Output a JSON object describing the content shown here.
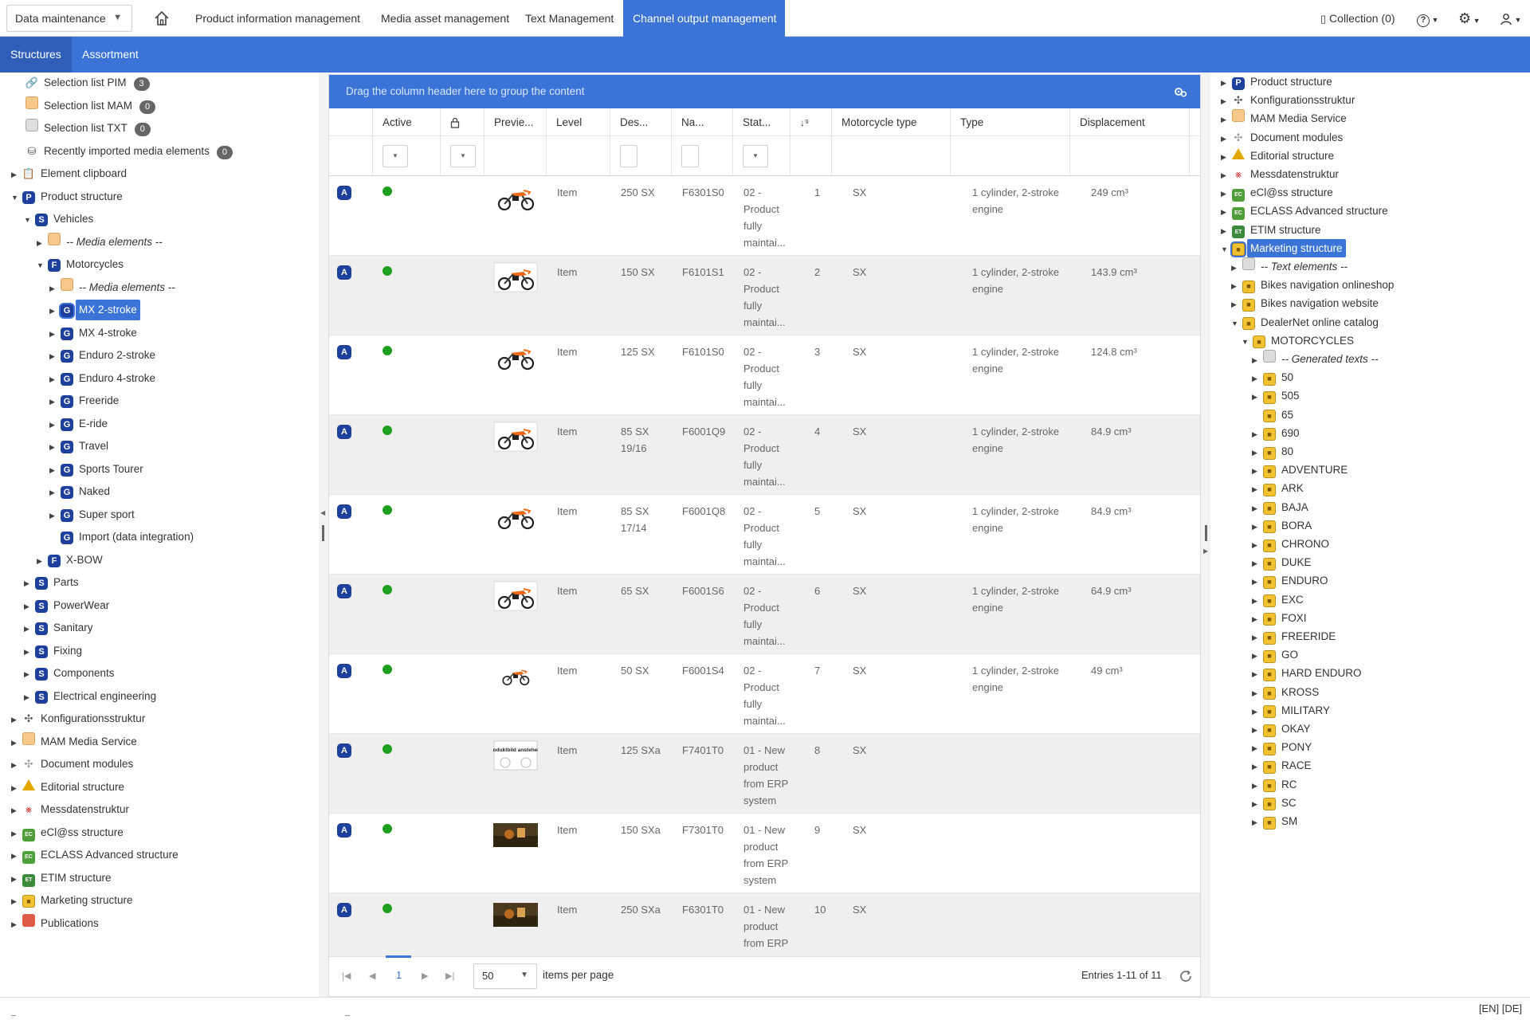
{
  "topbar": {
    "mode_select": "Data maintenance",
    "nav_tabs": [
      "Product information management",
      "Media asset management",
      "Text Management",
      "Channel output management"
    ],
    "collection": "Collection (0)"
  },
  "subtabs": [
    "Structures",
    "Assortment"
  ],
  "left_tree": [
    {
      "label": "Selection list PIM",
      "badge": "3"
    },
    {
      "label": "Selection list MAM",
      "badge": "0"
    },
    {
      "label": "Selection list TXT",
      "badge": "0"
    },
    {
      "label": "Recently imported media elements",
      "badge": "0"
    },
    {
      "label": "Element clipboard"
    },
    {
      "label": "Product structure"
    },
    {
      "label": "Vehicles"
    },
    {
      "label": "-- Media elements --"
    },
    {
      "label": "Motorcycles"
    },
    {
      "label": "-- Media elements --"
    },
    {
      "label": "MX 2-stroke"
    },
    {
      "label": "MX 4-stroke"
    },
    {
      "label": "Enduro 2-stroke"
    },
    {
      "label": "Enduro 4-stroke"
    },
    {
      "label": "Freeride"
    },
    {
      "label": "E-ride"
    },
    {
      "label": "Travel"
    },
    {
      "label": "Sports Tourer"
    },
    {
      "label": "Naked"
    },
    {
      "label": "Super sport"
    },
    {
      "label": "Import (data integration)"
    },
    {
      "label": "X-BOW"
    },
    {
      "label": "Parts"
    },
    {
      "label": "PowerWear"
    },
    {
      "label": "Sanitary"
    },
    {
      "label": "Fixing"
    },
    {
      "label": "Components"
    },
    {
      "label": "Electrical engineering"
    },
    {
      "label": "Konfigurationsstruktur"
    },
    {
      "label": "MAM Media Service"
    },
    {
      "label": "Document modules"
    },
    {
      "label": "Editorial structure"
    },
    {
      "label": "Messdatenstruktur"
    },
    {
      "label": "eCl@ss structure"
    },
    {
      "label": "ECLASS Advanced structure"
    },
    {
      "label": "ETIM structure"
    },
    {
      "label": "Marketing structure"
    },
    {
      "label": "Publications"
    }
  ],
  "grid": {
    "group_hint": "Drag the column header here to group the content",
    "columns": [
      "Active",
      "Previe...",
      "Level",
      "Des...",
      "Na...",
      "Stat...",
      "Motorcycle type",
      "Type",
      "Displacement"
    ],
    "rows": [
      {
        "badge": "A",
        "level": "Item",
        "desc": "250 SX",
        "name": "F6301S0",
        "status": "02 - Product fully maintai...",
        "order": "1",
        "moto": "SX",
        "type": "1 cylinder, 2-stroke engine",
        "disp": "249 cm³"
      },
      {
        "badge": "A",
        "level": "Item",
        "desc": "150 SX",
        "name": "F6101S1",
        "status": "02 - Product fully maintai...",
        "order": "2",
        "moto": "SX",
        "type": "1 cylinder, 2-stroke engine",
        "disp": "143.9 cm³"
      },
      {
        "badge": "A",
        "level": "Item",
        "desc": "125 SX",
        "name": "F6101S0",
        "status": "02 - Product fully maintai...",
        "order": "3",
        "moto": "SX",
        "type": "1 cylinder, 2-stroke engine",
        "disp": "124.8 cm³"
      },
      {
        "badge": "A",
        "level": "Item",
        "desc": "85 SX 19/16",
        "name": "F6001Q9",
        "status": "02 - Product fully maintai...",
        "order": "4",
        "moto": "SX",
        "type": "1 cylinder, 2-stroke engine",
        "disp": "84.9 cm³"
      },
      {
        "badge": "A",
        "level": "Item",
        "desc": "85 SX 17/14",
        "name": "F6001Q8",
        "status": "02 - Product fully maintai...",
        "order": "5",
        "moto": "SX",
        "type": "1 cylinder, 2-stroke engine",
        "disp": "84.9 cm³"
      },
      {
        "badge": "A",
        "level": "Item",
        "desc": "65 SX",
        "name": "F6001S6",
        "status": "02 - Product fully maintai...",
        "order": "6",
        "moto": "SX",
        "type": "1 cylinder, 2-stroke engine",
        "disp": "64.9 cm³"
      },
      {
        "badge": "A",
        "level": "Item",
        "desc": "50 SX",
        "name": "F6001S4",
        "status": "02 - Product fully maintai...",
        "order": "7",
        "moto": "SX",
        "type": "1 cylinder, 2-stroke engine",
        "disp": "49 cm³"
      },
      {
        "badge": "A",
        "level": "Item",
        "desc": "125 SXa",
        "name": "F7401T0",
        "status": "01 - New product from ERP system",
        "order": "8",
        "moto": "SX",
        "type": "",
        "disp": ""
      },
      {
        "badge": "A",
        "level": "Item",
        "desc": "150 SXa",
        "name": "F7301T0",
        "status": "01 - New product from ERP system",
        "order": "9",
        "moto": "SX",
        "type": "",
        "disp": ""
      },
      {
        "badge": "A",
        "level": "Item",
        "desc": "250 SXa",
        "name": "F6301T0",
        "status": "01 - New product from ERP",
        "order": "10",
        "moto": "SX",
        "type": "",
        "disp": ""
      }
    ],
    "thumb_placeholder_text": "Produktbild anstehend"
  },
  "pager": {
    "page": "1",
    "per_page": "50",
    "per_page_label": "items per page",
    "entries": "Entries 1-11 of 11"
  },
  "right_tree": [
    {
      "label": "Product structure"
    },
    {
      "label": "Konfigurationsstruktur"
    },
    {
      "label": "MAM Media Service"
    },
    {
      "label": "Document modules"
    },
    {
      "label": "Editorial structure"
    },
    {
      "label": "Messdatenstruktur"
    },
    {
      "label": "eCl@ss structure"
    },
    {
      "label": "ECLASS Advanced structure"
    },
    {
      "label": "ETIM structure"
    },
    {
      "label": "Marketing structure"
    },
    {
      "label": "-- Text elements --"
    },
    {
      "label": "Bikes navigation onlineshop"
    },
    {
      "label": "Bikes navigation website"
    },
    {
      "label": "DealerNet online catalog"
    },
    {
      "label": "MOTORCYCLES"
    },
    {
      "label": "-- Generated texts --"
    },
    {
      "label": "50"
    },
    {
      "label": "505"
    },
    {
      "label": "65"
    },
    {
      "label": "690"
    },
    {
      "label": "80"
    },
    {
      "label": "ADVENTURE"
    },
    {
      "label": "ARK"
    },
    {
      "label": "BAJA"
    },
    {
      "label": "BORA"
    },
    {
      "label": "CHRONO"
    },
    {
      "label": "DUKE"
    },
    {
      "label": "ENDURO"
    },
    {
      "label": "EXC"
    },
    {
      "label": "FOXI"
    },
    {
      "label": "FREERIDE"
    },
    {
      "label": "GO"
    },
    {
      "label": "HARD ENDURO"
    },
    {
      "label": "KROSS"
    },
    {
      "label": "MILITARY"
    },
    {
      "label": "OKAY"
    },
    {
      "label": "PONY"
    },
    {
      "label": "RACE"
    },
    {
      "label": "RC"
    },
    {
      "label": "SC"
    },
    {
      "label": "SM"
    }
  ],
  "statusbar": {
    "lang": "[EN] [DE]"
  },
  "colors": {
    "accent": "#3b74d6",
    "accent_dark": "#2f5fb8",
    "active_dot": "#1f9f1f",
    "node_icon": "#1d3f9e"
  }
}
